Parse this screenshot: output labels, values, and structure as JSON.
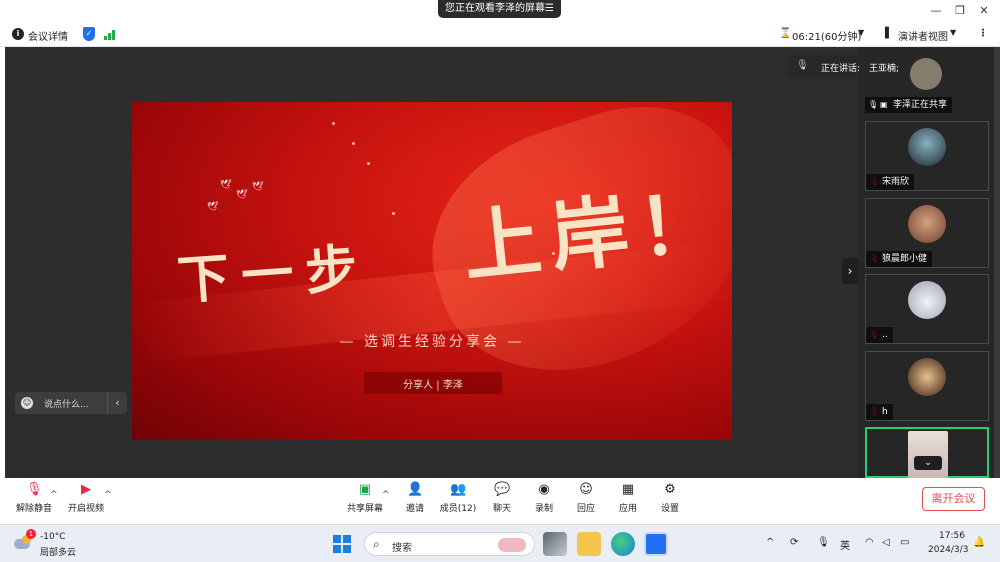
{
  "banner": {
    "share_status": "您正在观看李泽的屏幕",
    "menu_icon": "hamburger-icon"
  },
  "window_controls": {
    "minimize": "—",
    "restore": "❐",
    "close": "✕"
  },
  "toolbar": {
    "meeting_info": "会议详情",
    "timer": "06:21(60分钟)",
    "view_mode": "演讲者视图",
    "more": "⋮"
  },
  "slide": {
    "title_part1": "下一步",
    "title_part2": "上岸！",
    "subtitle": "—  选调生经验分享会  —",
    "presenter": "分享人 | 李泽"
  },
  "chat": {
    "placeholder": "说点什么...",
    "collapse": "‹"
  },
  "speaking": {
    "label": "正在讲话:",
    "name": "王亚楠;"
  },
  "participants": [
    {
      "name": "李泽正在共享",
      "avatar_color": "#c8b8a0"
    },
    {
      "name": "宋雨欣",
      "avatar_color": "#3a5a6a"
    },
    {
      "name": "狼晨郎小健",
      "avatar_color": "#c89070"
    },
    {
      "name": "..",
      "avatar_color": "#d8dce8"
    },
    {
      "name": "h",
      "avatar_color": "#a06838"
    },
    {
      "name": "",
      "avatar_color": "#e8d8d0"
    }
  ],
  "controls": {
    "unmute": "解除静音",
    "start_video": "开启视频",
    "share_screen": "共享屏幕",
    "invite": "邀请",
    "members": "成员(12)",
    "chat": "聊天",
    "record": "录制",
    "reactions": "回应",
    "apps": "应用",
    "settings": "设置",
    "leave": "离开会议"
  },
  "taskbar": {
    "temperature": "-10°C",
    "weather": "局部多云",
    "weather_badge": "1",
    "search_placeholder": "搜索",
    "ime": "英",
    "time": "17:56",
    "date": "2024/3/3"
  },
  "colors": {
    "accent_blue": "#1e6fe8",
    "leave_red": "#e34d4d",
    "active_green": "#2ecc71",
    "slide_red": "#c8130f"
  }
}
